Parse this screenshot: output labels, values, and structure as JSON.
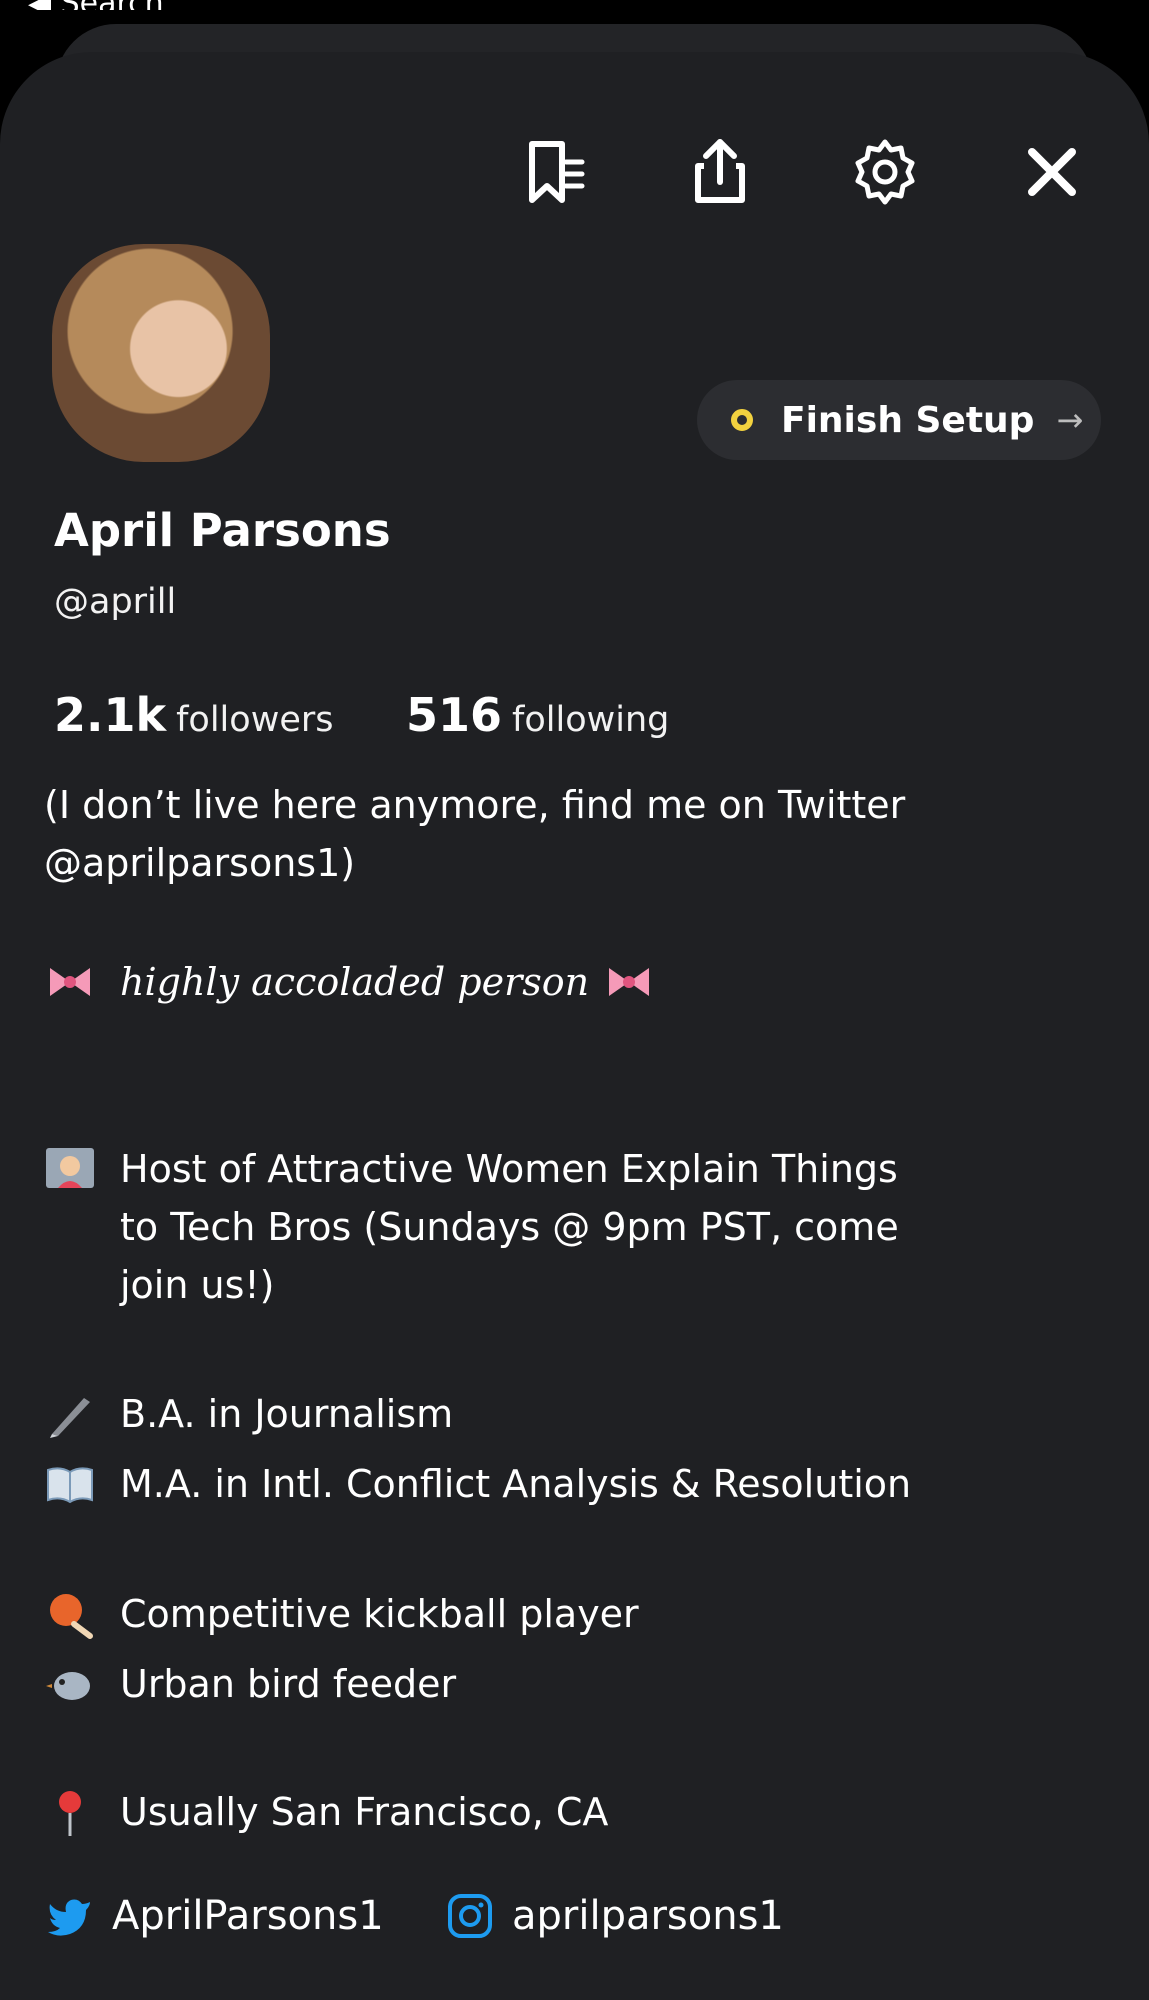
{
  "status": {
    "back_label": "◀ Search"
  },
  "toolbar": {
    "icons": [
      "bookmark-list-icon",
      "share-icon",
      "gear-icon",
      "close-icon"
    ]
  },
  "profile": {
    "name": "April Parsons",
    "handle": "@aprill",
    "followers_count": "2.1k",
    "followers_label": "followers",
    "following_count": "516",
    "following_label": "following",
    "finish_setup": "Finish Setup",
    "finish_arrow": "→"
  },
  "bio": {
    "intro_line1": "(I don’t live here anymore, find me on Twitter",
    "intro_line2": "@aprilparsons1)",
    "tagline": "highly accoladed person",
    "host_line1": "Host of Attractive Women Explain Things",
    "host_line2": "to Tech Bros (Sundays @ 9pm PST, come",
    "host_line3": "join us!)",
    "degree_ba": "B.A. in Journalism",
    "degree_ma": "M.A. in Intl. Conflict Analysis & Resolution",
    "hobby_kickball": "Competitive kickball player",
    "hobby_bird": "Urban bird feeder",
    "location": "Usually San Francisco, CA"
  },
  "social": {
    "twitter": "AprilParsons1",
    "instagram": "aprilparsons1"
  },
  "colors": {
    "background": "#1f2023",
    "accent_yellow": "#f3d23f",
    "twitter_blue": "#1d9bf0"
  }
}
